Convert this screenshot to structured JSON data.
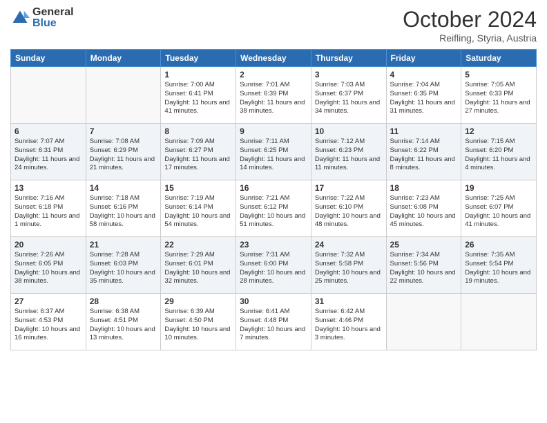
{
  "logo": {
    "general": "General",
    "blue": "Blue"
  },
  "title": "October 2024",
  "location": "Reifling, Styria, Austria",
  "weekdays": [
    "Sunday",
    "Monday",
    "Tuesday",
    "Wednesday",
    "Thursday",
    "Friday",
    "Saturday"
  ],
  "weeks": [
    [
      {
        "day": "",
        "info": ""
      },
      {
        "day": "",
        "info": ""
      },
      {
        "day": "1",
        "info": "Sunrise: 7:00 AM\nSunset: 6:41 PM\nDaylight: 11 hours and 41 minutes."
      },
      {
        "day": "2",
        "info": "Sunrise: 7:01 AM\nSunset: 6:39 PM\nDaylight: 11 hours and 38 minutes."
      },
      {
        "day": "3",
        "info": "Sunrise: 7:03 AM\nSunset: 6:37 PM\nDaylight: 11 hours and 34 minutes."
      },
      {
        "day": "4",
        "info": "Sunrise: 7:04 AM\nSunset: 6:35 PM\nDaylight: 11 hours and 31 minutes."
      },
      {
        "day": "5",
        "info": "Sunrise: 7:05 AM\nSunset: 6:33 PM\nDaylight: 11 hours and 27 minutes."
      }
    ],
    [
      {
        "day": "6",
        "info": "Sunrise: 7:07 AM\nSunset: 6:31 PM\nDaylight: 11 hours and 24 minutes."
      },
      {
        "day": "7",
        "info": "Sunrise: 7:08 AM\nSunset: 6:29 PM\nDaylight: 11 hours and 21 minutes."
      },
      {
        "day": "8",
        "info": "Sunrise: 7:09 AM\nSunset: 6:27 PM\nDaylight: 11 hours and 17 minutes."
      },
      {
        "day": "9",
        "info": "Sunrise: 7:11 AM\nSunset: 6:25 PM\nDaylight: 11 hours and 14 minutes."
      },
      {
        "day": "10",
        "info": "Sunrise: 7:12 AM\nSunset: 6:23 PM\nDaylight: 11 hours and 11 minutes."
      },
      {
        "day": "11",
        "info": "Sunrise: 7:14 AM\nSunset: 6:22 PM\nDaylight: 11 hours and 8 minutes."
      },
      {
        "day": "12",
        "info": "Sunrise: 7:15 AM\nSunset: 6:20 PM\nDaylight: 11 hours and 4 minutes."
      }
    ],
    [
      {
        "day": "13",
        "info": "Sunrise: 7:16 AM\nSunset: 6:18 PM\nDaylight: 11 hours and 1 minute."
      },
      {
        "day": "14",
        "info": "Sunrise: 7:18 AM\nSunset: 6:16 PM\nDaylight: 10 hours and 58 minutes."
      },
      {
        "day": "15",
        "info": "Sunrise: 7:19 AM\nSunset: 6:14 PM\nDaylight: 10 hours and 54 minutes."
      },
      {
        "day": "16",
        "info": "Sunrise: 7:21 AM\nSunset: 6:12 PM\nDaylight: 10 hours and 51 minutes."
      },
      {
        "day": "17",
        "info": "Sunrise: 7:22 AM\nSunset: 6:10 PM\nDaylight: 10 hours and 48 minutes."
      },
      {
        "day": "18",
        "info": "Sunrise: 7:23 AM\nSunset: 6:08 PM\nDaylight: 10 hours and 45 minutes."
      },
      {
        "day": "19",
        "info": "Sunrise: 7:25 AM\nSunset: 6:07 PM\nDaylight: 10 hours and 41 minutes."
      }
    ],
    [
      {
        "day": "20",
        "info": "Sunrise: 7:26 AM\nSunset: 6:05 PM\nDaylight: 10 hours and 38 minutes."
      },
      {
        "day": "21",
        "info": "Sunrise: 7:28 AM\nSunset: 6:03 PM\nDaylight: 10 hours and 35 minutes."
      },
      {
        "day": "22",
        "info": "Sunrise: 7:29 AM\nSunset: 6:01 PM\nDaylight: 10 hours and 32 minutes."
      },
      {
        "day": "23",
        "info": "Sunrise: 7:31 AM\nSunset: 6:00 PM\nDaylight: 10 hours and 28 minutes."
      },
      {
        "day": "24",
        "info": "Sunrise: 7:32 AM\nSunset: 5:58 PM\nDaylight: 10 hours and 25 minutes."
      },
      {
        "day": "25",
        "info": "Sunrise: 7:34 AM\nSunset: 5:56 PM\nDaylight: 10 hours and 22 minutes."
      },
      {
        "day": "26",
        "info": "Sunrise: 7:35 AM\nSunset: 5:54 PM\nDaylight: 10 hours and 19 minutes."
      }
    ],
    [
      {
        "day": "27",
        "info": "Sunrise: 6:37 AM\nSunset: 4:53 PM\nDaylight: 10 hours and 16 minutes."
      },
      {
        "day": "28",
        "info": "Sunrise: 6:38 AM\nSunset: 4:51 PM\nDaylight: 10 hours and 13 minutes."
      },
      {
        "day": "29",
        "info": "Sunrise: 6:39 AM\nSunset: 4:50 PM\nDaylight: 10 hours and 10 minutes."
      },
      {
        "day": "30",
        "info": "Sunrise: 6:41 AM\nSunset: 4:48 PM\nDaylight: 10 hours and 7 minutes."
      },
      {
        "day": "31",
        "info": "Sunrise: 6:42 AM\nSunset: 4:46 PM\nDaylight: 10 hours and 3 minutes."
      },
      {
        "day": "",
        "info": ""
      },
      {
        "day": "",
        "info": ""
      }
    ]
  ]
}
